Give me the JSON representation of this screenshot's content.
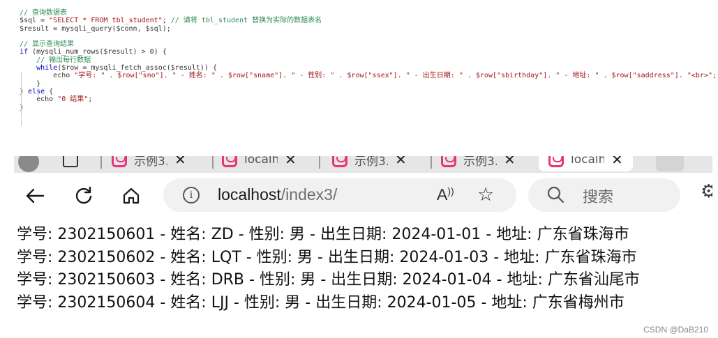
{
  "code": {
    "comment_query": "// 查询数据表",
    "sql_prefix": "$sql = ",
    "sql_string": "\"SELECT * FROM tbl_student\"",
    "sql_suffix": "; ",
    "comment_replace": "// 请将 tbl_student 替换为实际的数据表名",
    "result_line": "$result = mysqli_query($conn, $sql);",
    "comment_show": "// 显示查询结果",
    "if_keyword": "if",
    "if_rest": " (mysqli_num_rows($result) > 0) {",
    "comment_output": "// 输出每行数据",
    "while_keyword": "while",
    "while_rest": "($row = mysqli_fetch_assoc($result)) {",
    "echo_keyword": "echo ",
    "echo_line": "\"学号: \" . $row[\"sno\"]. \" - 姓名: \" . $row[\"sname\"]. \" - 性别: \" . $row[\"ssex\"]. \" - 出生日期: \" . $row[\"sbirthday\"]. \" - 地址: \" . $row[\"saddress\"]. \"<br>\";",
    "close_brace": "}",
    "else_open": "} ",
    "else_keyword": "else",
    "else_brace": " {",
    "echo_zero_keyword": "echo ",
    "echo_zero": "\"0 结果\"",
    "echo_zero_end": ";"
  },
  "browser": {
    "tabs": [
      {
        "label": "示例3.",
        "close": "✕"
      },
      {
        "label": "localh",
        "close": "✕"
      },
      {
        "label": "示例3.",
        "close": "✕"
      },
      {
        "label": "示例3.",
        "close": "✕"
      },
      {
        "label": "localh",
        "close": "✕"
      }
    ],
    "back_icon": "back-arrow-icon",
    "refresh_icon": "refresh-icon",
    "home_icon": "home-icon",
    "url_host": "localhost",
    "url_path": "/index3/",
    "search_placeholder": "搜索",
    "read_aloud_label": "A",
    "star_glyph": "☆"
  },
  "results": [
    "学号: 2302150601 - 姓名: ZD - 性别: 男 - 出生日期: 2024-01-01 - 地址: 广东省珠海市",
    "学号: 2302150602 - 姓名: LQT - 性别: 男 - 出生日期: 2024-01-03 - 地址: 广东省珠海市",
    "学号: 2302150603 - 姓名: DRB - 性别: 男 - 出生日期: 2024-01-04 - 地址: 广东省汕尾市",
    "学号: 2302150604 - 姓名: LJJ - 性别: 男 - 出生日期: 2024-01-05 - 地址: 广东省梅州市"
  ],
  "watermark": "CSDN @DaB210",
  "colors": {
    "comment": "#2e8b57",
    "keyword": "#0000cc",
    "string": "#a31515",
    "tab_favicon": "#e8357a"
  }
}
